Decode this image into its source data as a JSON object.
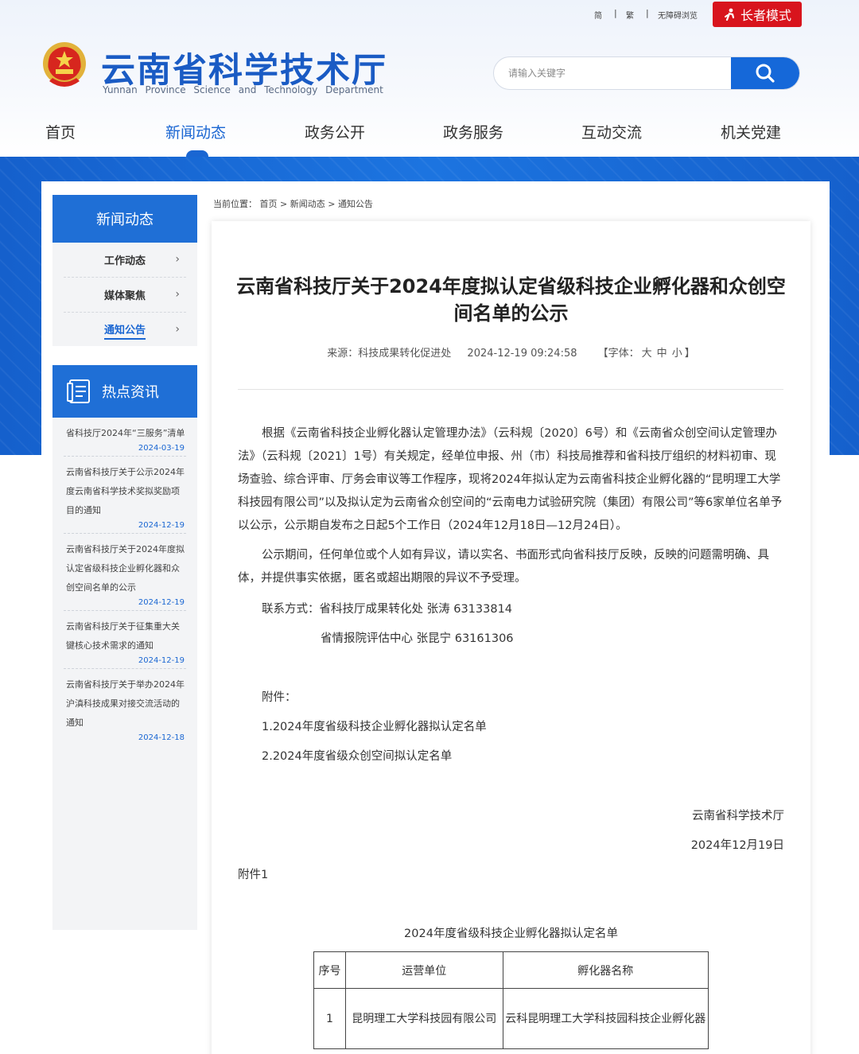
{
  "header": {
    "util_links": [
      "简",
      "繁",
      "无障碍浏览"
    ],
    "util_sep": "|",
    "elder_mode": "长者模式",
    "site_title": "云南省科学技术厅",
    "site_subtitle": "Yunnan Province Science and Technology Department",
    "search_placeholder": "请输入关键字"
  },
  "nav": {
    "items": [
      "首页",
      "新闻动态",
      "政务公开",
      "政务服务",
      "互动交流",
      "机关党建"
    ],
    "active_index": 1
  },
  "sidebar": {
    "section_title": "新闻动态",
    "items": [
      {
        "label": "工作动态",
        "chevron": "›"
      },
      {
        "label": "媒体聚焦",
        "chevron": "›"
      },
      {
        "label": "通知公告",
        "chevron": "›"
      }
    ],
    "active_index": 2,
    "hot_title": "热点资讯",
    "hot_items": [
      {
        "title": "省科技厅2024年“三服务”清单",
        "date": "2024-03-19"
      },
      {
        "title": "云南省科技厅关于公示2024年度云南省科学技术奖拟奖励项目的通知",
        "date": "2024-12-19"
      },
      {
        "title": "云南省科技厅关于2024年度拟认定省级科技企业孵化器和众创空间名单的公示",
        "date": "2024-12-19"
      },
      {
        "title": "云南省科技厅关于征集重大关键核心技术需求的通知",
        "date": "2024-12-19"
      },
      {
        "title": "云南省科技厅关于举办2024年沪滇科技成果对接交流活动的通知",
        "date": "2024-12-18"
      }
    ]
  },
  "breadcrumb": {
    "prefix": "当前位置：",
    "items": [
      "首页",
      "新闻动态",
      "通知公告"
    ],
    "sep": ">"
  },
  "article": {
    "title": "云南省科技厅关于2024年度拟认定省级科技企业孵化器和众创空间名单的公示",
    "source": "来源：科技成果转化促进处",
    "datetime": "2024-12-19 09:24:58",
    "font_label": "【字体：",
    "font_sizes": [
      "大",
      "中",
      "小"
    ],
    "font_close": "】",
    "paragraph1": "根据《云南省科技企业孵化器认定管理办法》（云科规〔2020〕6号）和《云南省众创空间认定管理办法》（云科规〔2021〕1号）有关规定，经单位申报、州（市）科技局推荐和省科技厅组织的材料初审、现场查验、综合评审、厅务会审议等工作程序，现将2024年拟认定为云南省科技企业孵化器的“昆明理工大学科技园有限公司”以及拟认定为云南省众创空间的“云南电力试验研究院（集团）有限公司”等6家单位名单予以公示，公示期自发布之日起5个工作日（2024年12月18日—12月24日）。",
    "paragraph2": "公示期间，任何单位或个人如有异议，请以实名、书面形式向省科技厅反映，反映的问题需明确、具体，并提供事实依据，匿名或超出期限的异议不予受理。",
    "contact1": "联系方式：省科技厅成果转化处 张涛 63133814",
    "contact2": "省情报院评估中心 张昆宁 63161306",
    "attach_label": "附件：",
    "attach1": "1.2024年度省级科技企业孵化器拟认定名单",
    "attach2": "2.2024年度省级众创空间拟认定名单",
    "signature_org": "云南省科学技术厅",
    "signature_date": "2024年12月19日",
    "appendix_label": "附件1",
    "table_title": "2024年度省级科技企业孵化器拟认定名单",
    "table": {
      "headers": [
        "序号",
        "运营单位",
        "孵化器名称"
      ],
      "rows": [
        [
          "1",
          "昆明理工大学科技园有限公司",
          "云科昆明理工大学科技园科技企业孵化器"
        ]
      ]
    }
  },
  "colors": {
    "brand_blue": "#1f6fd6",
    "elder_red": "#d8141d",
    "link_blue": "#1a66d2"
  }
}
